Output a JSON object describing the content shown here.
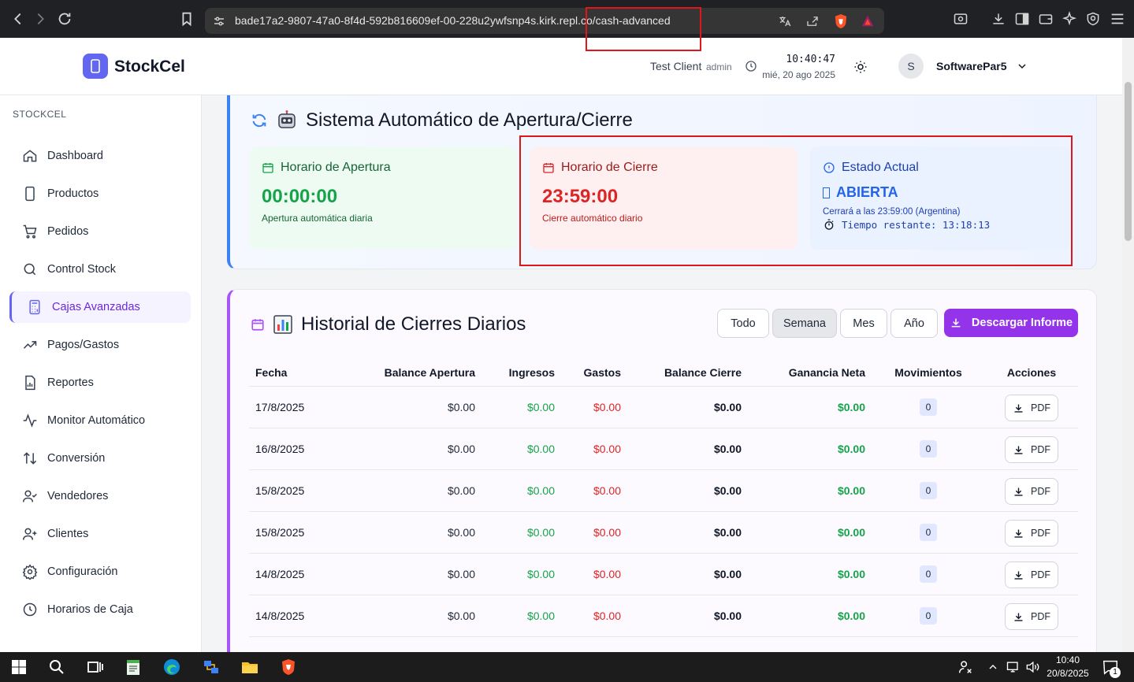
{
  "browser": {
    "url_prefix": "bade17a2-9807-47a0-8f4d-592b816609ef-00-228u2ywfsnp4s.kirk.repl.co",
    "url_path": "/cash-advanced"
  },
  "header": {
    "brand": "StockCel",
    "client": "Test Client",
    "role": "admin",
    "time": "10:40:47",
    "date": "mié, 20 ago 2025",
    "avatar_initial": "S",
    "username": "SoftwarePar5"
  },
  "sidebar": {
    "section": "STOCKCEL",
    "items": [
      {
        "label": "Dashboard",
        "icon": "home-icon"
      },
      {
        "label": "Productos",
        "icon": "phone-icon"
      },
      {
        "label": "Pedidos",
        "icon": "cart-icon"
      },
      {
        "label": "Control Stock",
        "icon": "search-icon"
      },
      {
        "label": "Cajas Avanzadas",
        "icon": "calculator-icon"
      },
      {
        "label": "Pagos/Gastos",
        "icon": "trend-icon"
      },
      {
        "label": "Reportes",
        "icon": "report-icon"
      },
      {
        "label": "Monitor Automático",
        "icon": "activity-icon"
      },
      {
        "label": "Conversión",
        "icon": "arrows-icon"
      },
      {
        "label": "Vendedores",
        "icon": "user-check-icon"
      },
      {
        "label": "Clientes",
        "icon": "user-plus-icon"
      },
      {
        "label": "Configuración",
        "icon": "gear-icon"
      },
      {
        "label": "Horarios de Caja",
        "icon": "clock-icon"
      }
    ]
  },
  "auto_system": {
    "title": "Sistema Automático de Apertura/Cierre",
    "opening": {
      "label": "Horario de Apertura",
      "time": "00:00:00",
      "desc": "Apertura automática diaria"
    },
    "closing": {
      "label": "Horario de Cierre",
      "time": "23:59:00",
      "desc": "Cierre automático diario"
    },
    "status": {
      "label": "Estado Actual",
      "value": "ABIERTA",
      "closes_at": "Cerrará a las 23:59:00 (Argentina)",
      "remaining": "Tiempo restante: 13:18:13"
    }
  },
  "history": {
    "title": "Historial de Cierres Diarios",
    "filters": [
      "Todo",
      "Semana",
      "Mes",
      "Año"
    ],
    "selected_filter": "Semana",
    "download_label": "Descargar Informe",
    "columns": [
      "Fecha",
      "Balance Apertura",
      "Ingresos",
      "Gastos",
      "Balance Cierre",
      "Ganancia Neta",
      "Movimientos",
      "Acciones"
    ],
    "rows": [
      {
        "fecha": "17/8/2025",
        "apertura": "$0.00",
        "ingresos": "$0.00",
        "gastos": "$0.00",
        "cierre": "$0.00",
        "ganancia": "$0.00",
        "movimientos": "0",
        "accion": "PDF"
      },
      {
        "fecha": "16/8/2025",
        "apertura": "$0.00",
        "ingresos": "$0.00",
        "gastos": "$0.00",
        "cierre": "$0.00",
        "ganancia": "$0.00",
        "movimientos": "0",
        "accion": "PDF"
      },
      {
        "fecha": "15/8/2025",
        "apertura": "$0.00",
        "ingresos": "$0.00",
        "gastos": "$0.00",
        "cierre": "$0.00",
        "ganancia": "$0.00",
        "movimientos": "0",
        "accion": "PDF"
      },
      {
        "fecha": "15/8/2025",
        "apertura": "$0.00",
        "ingresos": "$0.00",
        "gastos": "$0.00",
        "cierre": "$0.00",
        "ganancia": "$0.00",
        "movimientos": "0",
        "accion": "PDF"
      },
      {
        "fecha": "14/8/2025",
        "apertura": "$0.00",
        "ingresos": "$0.00",
        "gastos": "$0.00",
        "cierre": "$0.00",
        "ganancia": "$0.00",
        "movimientos": "0",
        "accion": "PDF"
      },
      {
        "fecha": "14/8/2025",
        "apertura": "$0.00",
        "ingresos": "$0.00",
        "gastos": "$0.00",
        "cierre": "$0.00",
        "ganancia": "$0.00",
        "movimientos": "0",
        "accion": "PDF"
      }
    ]
  },
  "taskbar": {
    "time": "10:40",
    "date": "20/8/2025",
    "notification_count": "1"
  },
  "colors": {
    "accent": "#6366f1",
    "green": "#16a34a",
    "red": "#dc2626",
    "blue": "#2563eb",
    "purple": "#9333ea"
  }
}
